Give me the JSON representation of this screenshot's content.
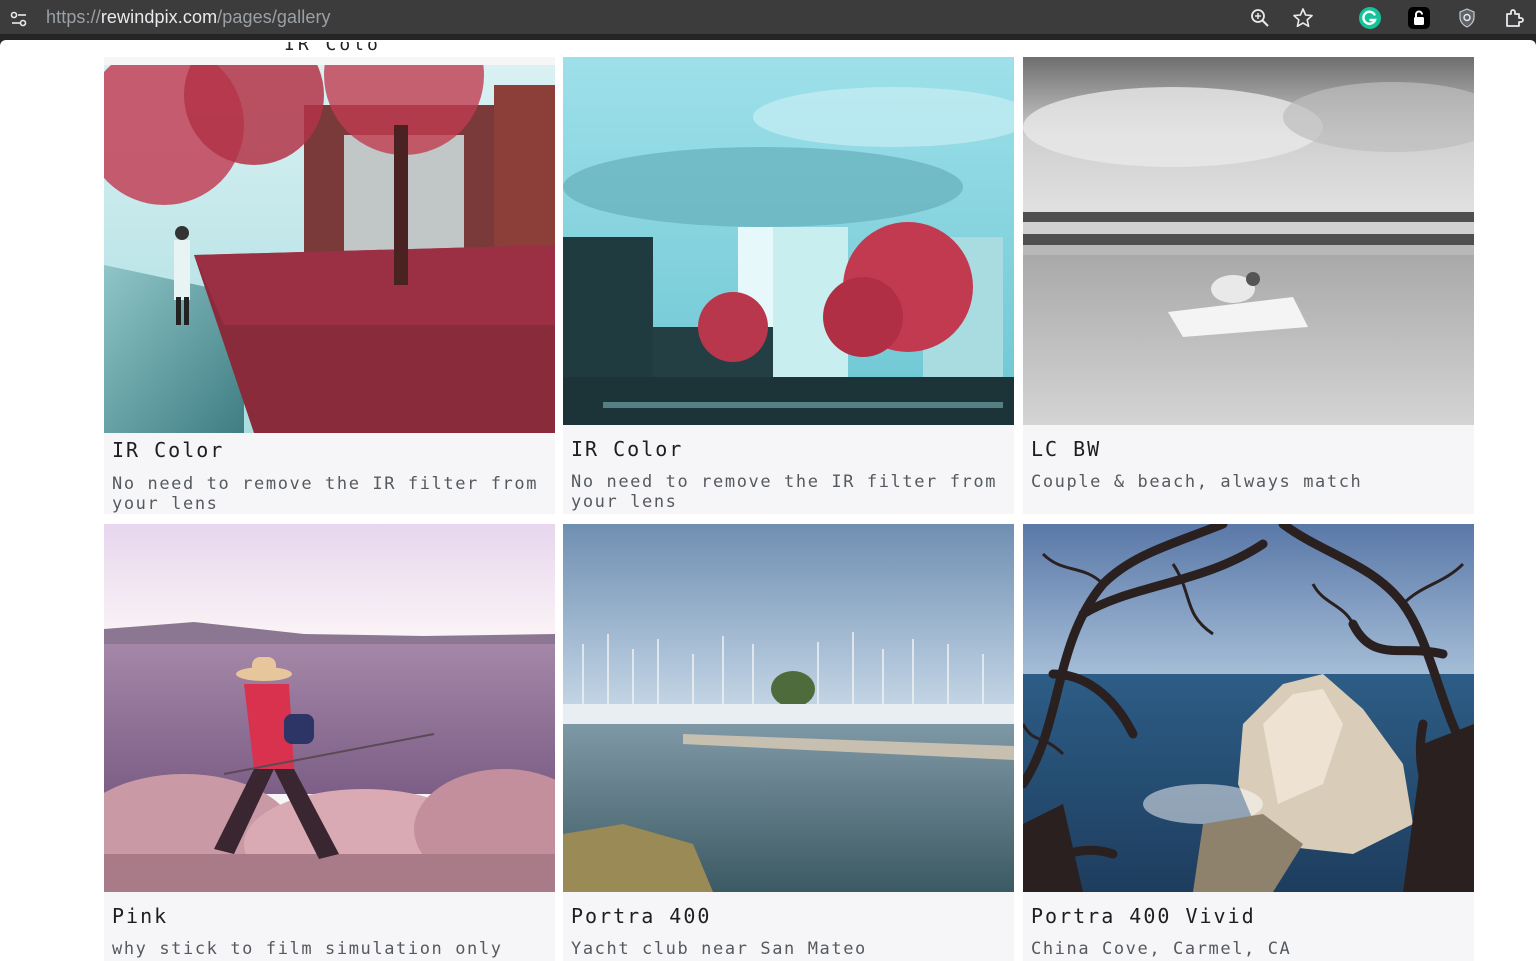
{
  "browser": {
    "url_prefix": "https://",
    "url_host": "rewindpix.com",
    "url_path": "/pages/gallery",
    "icons": [
      "site-info-icon",
      "zoom-icon",
      "star-icon",
      "grammarly-icon",
      "lock-extension-icon",
      "shield-extension-icon",
      "puzzle-icon"
    ]
  },
  "cutoff_label": "IR Color",
  "gallery": [
    {
      "title": "IR Color",
      "description": "No need to remove the IR filter from your lens"
    },
    {
      "title": "IR Color",
      "description": "No need to remove the IR filter from your lens"
    },
    {
      "title": "LC BW",
      "description": "Couple & beach, always match"
    },
    {
      "title": "Pink",
      "description": "why stick to film simulation only"
    },
    {
      "title": "Portra 400",
      "description": "Yacht club near San Mateo"
    },
    {
      "title": "Portra 400 Vivid",
      "description": "China Cove, Carmel, CA"
    }
  ]
}
